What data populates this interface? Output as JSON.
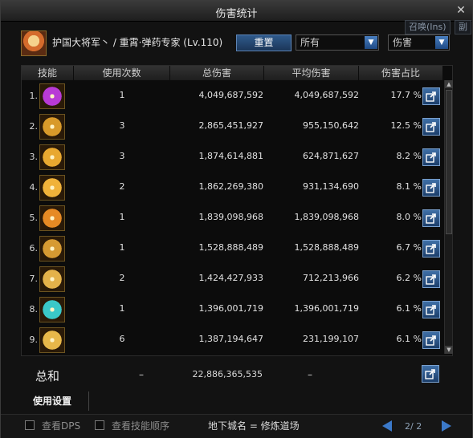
{
  "window": {
    "title": "伤害统计",
    "close_glyph": "✕"
  },
  "background_tabs": [
    "召唤(Ins)",
    "副"
  ],
  "header": {
    "character_name": "护国大将军丶 / 重霄·弹药专家 (Lv.110)",
    "reset_label": "重置",
    "filter_select": {
      "value": "所有"
    },
    "sort_select": {
      "value": "伤害"
    }
  },
  "table": {
    "columns": [
      "技能",
      "使用次数",
      "总伤害",
      "平均伤害",
      "伤害占比"
    ],
    "rows": [
      {
        "rank": "1.",
        "uses": "1",
        "total": "4,049,687,592",
        "avg": "4,049,687,592",
        "pct": "17.7 %",
        "icon": "skill-icon-1",
        "color": "#b83ad6"
      },
      {
        "rank": "2.",
        "uses": "3",
        "total": "2,865,451,927",
        "avg": "955,150,642",
        "pct": "12.5 %",
        "icon": "skill-icon-2",
        "color": "#d89a2a"
      },
      {
        "rank": "3.",
        "uses": "3",
        "total": "1,874,614,881",
        "avg": "624,871,627",
        "pct": "8.2 %",
        "icon": "skill-icon-3",
        "color": "#e8a830"
      },
      {
        "rank": "4.",
        "uses": "2",
        "total": "1,862,269,380",
        "avg": "931,134,690",
        "pct": "8.1 %",
        "icon": "skill-icon-4",
        "color": "#f0b23a"
      },
      {
        "rank": "5.",
        "uses": "1",
        "total": "1,839,098,968",
        "avg": "1,839,098,968",
        "pct": "8.0 %",
        "icon": "skill-icon-5",
        "color": "#e68a24"
      },
      {
        "rank": "6.",
        "uses": "1",
        "total": "1,528,888,489",
        "avg": "1,528,888,489",
        "pct": "6.7 %",
        "icon": "skill-icon-6",
        "color": "#d69a32"
      },
      {
        "rank": "7.",
        "uses": "2",
        "total": "1,424,427,933",
        "avg": "712,213,966",
        "pct": "6.2 %",
        "icon": "skill-icon-7",
        "color": "#e4b24a"
      },
      {
        "rank": "8.",
        "uses": "1",
        "total": "1,396,001,719",
        "avg": "1,396,001,719",
        "pct": "6.1 %",
        "icon": "skill-icon-8",
        "color": "#3ac8c8"
      },
      {
        "rank": "9.",
        "uses": "6",
        "total": "1,387,194,647",
        "avg": "231,199,107",
        "pct": "6.1 %",
        "icon": "skill-icon-9",
        "color": "#e8b84a"
      }
    ]
  },
  "totals": {
    "label": "总和",
    "uses": "–",
    "total": "22,886,365,535",
    "avg": "–"
  },
  "settings_tab": "使用设置",
  "bottom": {
    "dps_label": "查看DPS",
    "order_label": "查看技能顺序",
    "dungeon": "地下城名 = 修炼道场",
    "page": "2/ 2"
  }
}
